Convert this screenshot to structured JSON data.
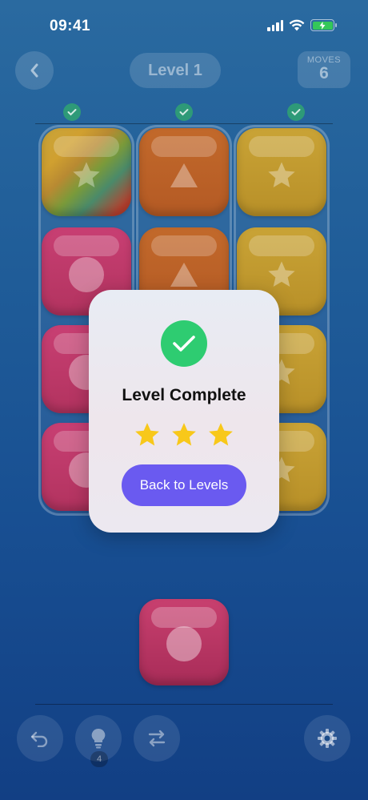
{
  "status_bar": {
    "time": "09:41"
  },
  "header": {
    "level_label": "Level 1",
    "moves_label": "MOVES",
    "moves_value": "6"
  },
  "columns": [
    {
      "completed": true,
      "tiles": [
        {
          "color": "rainbow",
          "shape": "star-icon"
        },
        {
          "color": "pink",
          "shape": "circle-icon"
        },
        {
          "color": "pink",
          "shape": "circle-icon"
        },
        {
          "color": "pink",
          "shape": "circle-icon"
        }
      ]
    },
    {
      "completed": true,
      "tiles": [
        {
          "color": "orange",
          "shape": "triangle-icon"
        },
        {
          "color": "orange",
          "shape": "triangle-icon"
        },
        {
          "color": "orange",
          "shape": "triangle-icon"
        },
        {
          "color": "orange",
          "shape": "triangle-icon"
        }
      ]
    },
    {
      "completed": true,
      "tiles": [
        {
          "color": "yellow",
          "shape": "star-icon"
        },
        {
          "color": "yellow",
          "shape": "star-icon"
        },
        {
          "color": "yellow",
          "shape": "star-icon"
        },
        {
          "color": "yellow",
          "shape": "star-icon"
        }
      ]
    }
  ],
  "active_tile": {
    "color": "pink",
    "shape": "circle-icon"
  },
  "toolbar": {
    "hint_count": "4",
    "icons": [
      "undo-icon",
      "lightbulb-icon",
      "swap-icon",
      "gear-icon"
    ]
  },
  "modal": {
    "title": "Level Complete",
    "stars": 3,
    "button_label": "Back to Levels",
    "colors": {
      "check": "#2ecc71",
      "star": "#f8c81a",
      "button": "#6a5af0"
    }
  }
}
